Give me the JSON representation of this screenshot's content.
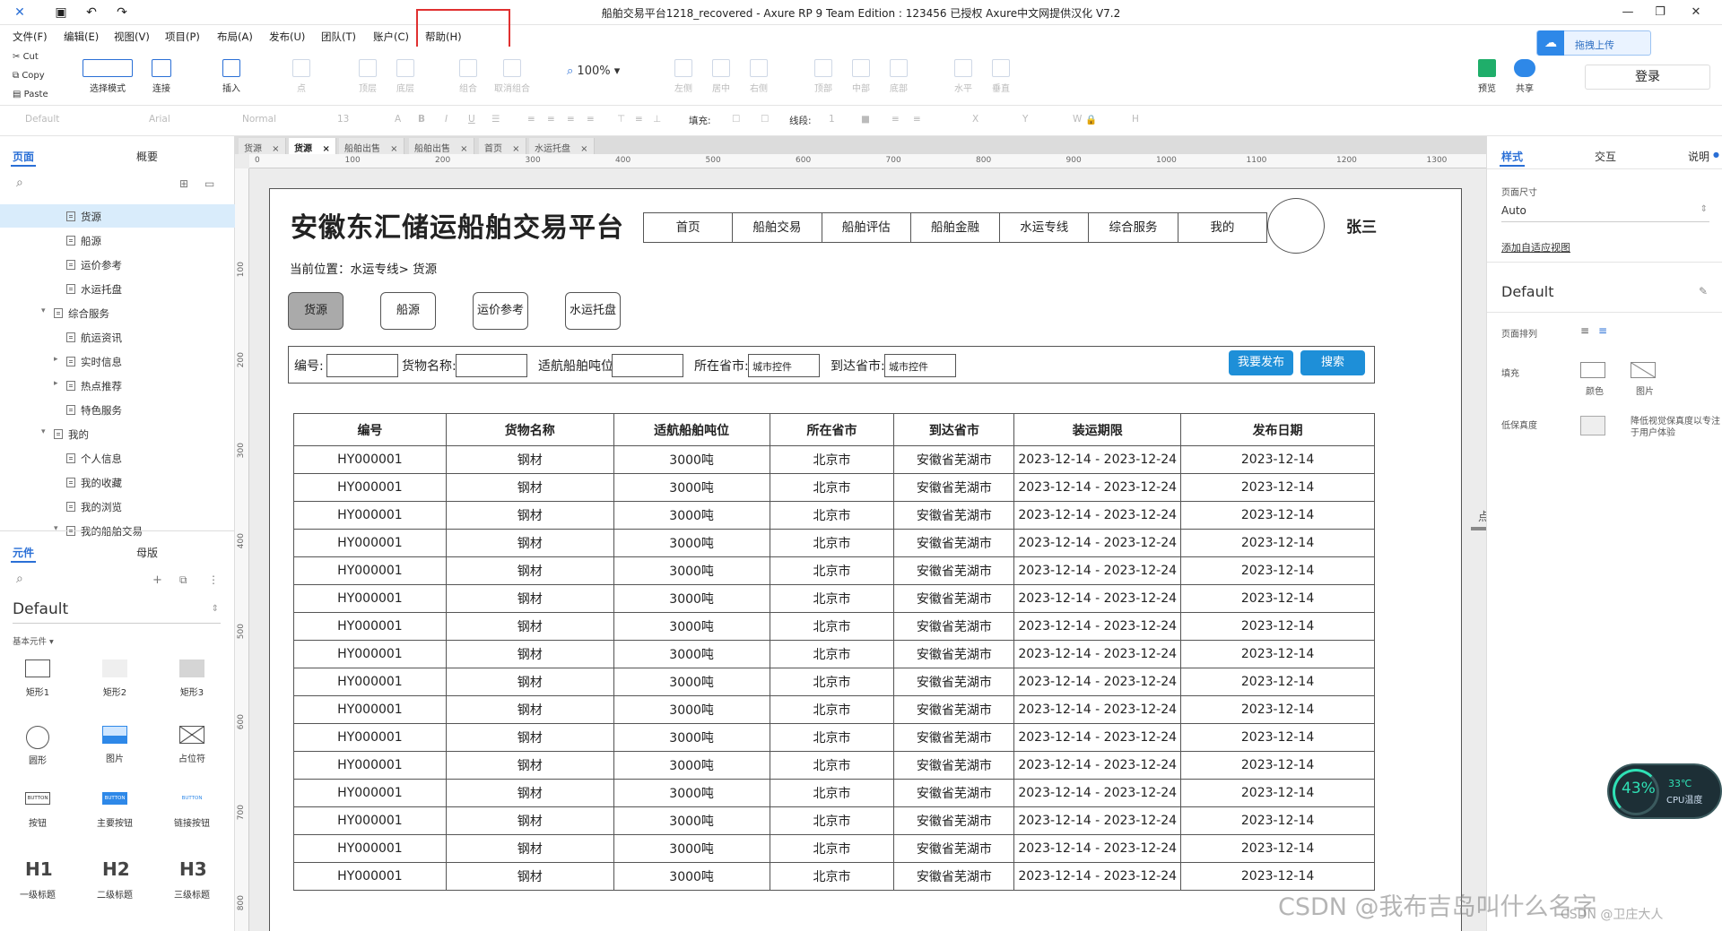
{
  "window": {
    "title": "船舶交易平台1218_recovered - Axure RP 9 Team Edition : 123456 已授权      Axure中文网提供汉化 V7.2"
  },
  "menu": [
    "文件(F)",
    "编辑(E)",
    "视图(V)",
    "项目(P)",
    "布局(A)",
    "发布(U)",
    "团队(T)",
    "账户(C)",
    "帮助(H)"
  ],
  "clipboard": {
    "cut": "Cut",
    "copy": "Copy",
    "paste": "Paste"
  },
  "toolbar": {
    "select_mode": "选择模式",
    "connect": "连接",
    "insert": "插入",
    "point": "点",
    "top_layer": "顶层",
    "bottom_layer": "底层",
    "group": "组合",
    "ungroup": "取消组合",
    "zoom": "100%",
    "align_left": "左侧",
    "align_center": "居中",
    "align_right": "右侧",
    "align_top": "顶部",
    "align_middle": "中部",
    "align_bottom": "底部",
    "dist_h": "水平",
    "dist_v": "垂直",
    "preview": "预览",
    "share": "共享",
    "upload": "拖拽上传",
    "login": "登录"
  },
  "format": {
    "style": "Default",
    "font": "Arial",
    "weight": "Normal",
    "size": "13",
    "fill": "填充:",
    "line": "线段:",
    "line_width": "1",
    "x": "X",
    "y": "Y",
    "w": "W",
    "h": "H"
  },
  "left_panel": {
    "tabs": [
      "页面",
      "概要"
    ],
    "pages": [
      {
        "label": "货源",
        "indent": 1,
        "selected": true
      },
      {
        "label": "船源",
        "indent": 1
      },
      {
        "label": "运价参考",
        "indent": 1
      },
      {
        "label": "水运托盘",
        "indent": 1
      },
      {
        "label": "综合服务",
        "indent": 0,
        "arrow": "▾"
      },
      {
        "label": "航运资讯",
        "indent": 1
      },
      {
        "label": "实时信息",
        "indent": 1,
        "arrow": "▸"
      },
      {
        "label": "热点推荐",
        "indent": 1,
        "arrow": "▸"
      },
      {
        "label": "特色服务",
        "indent": 1
      },
      {
        "label": "我的",
        "indent": 0,
        "arrow": "▾"
      },
      {
        "label": "个人信息",
        "indent": 1
      },
      {
        "label": "我的收藏",
        "indent": 1
      },
      {
        "label": "我的浏览",
        "indent": 1
      },
      {
        "label": "我的船舶交易",
        "indent": 1,
        "arrow": "▾"
      }
    ],
    "widget_tabs": [
      "元件",
      "母版"
    ],
    "library": "Default",
    "library_section": "基本元件 ▾",
    "widgets": [
      {
        "label": "矩形1",
        "icon": "rect-icon"
      },
      {
        "label": "矩形2",
        "icon": "rect-gray-icon"
      },
      {
        "label": "矩形3",
        "icon": "rect-dark-icon"
      },
      {
        "label": "圆形",
        "icon": "circle-icon"
      },
      {
        "label": "图片",
        "icon": "image-icon"
      },
      {
        "label": "占位符",
        "icon": "placeholder-icon"
      },
      {
        "label": "按钮",
        "icon": "button-icon",
        "text": "BUTTON"
      },
      {
        "label": "主要按钮",
        "icon": "primary-button-icon",
        "text": "BUTTON"
      },
      {
        "label": "链接按钮",
        "icon": "link-button-icon",
        "text": "BUTTON"
      },
      {
        "label": "一级标题",
        "icon": "h1-icon",
        "text": "H1"
      },
      {
        "label": "二级标题",
        "icon": "h2-icon",
        "text": "H2"
      },
      {
        "label": "三级标题",
        "icon": "h3-icon",
        "text": "H3"
      }
    ]
  },
  "doc_tabs": [
    {
      "label": "货源",
      "active": false
    },
    {
      "label": "货源",
      "active": true
    },
    {
      "label": "船舶出售",
      "active": false
    },
    {
      "label": "船舶出售",
      "active": false
    },
    {
      "label": "首页",
      "active": false
    },
    {
      "label": "水运托盘",
      "active": false
    }
  ],
  "ruler": {
    "h": [
      "0",
      "100",
      "200",
      "300",
      "400",
      "500",
      "600",
      "700",
      "800",
      "900",
      "1000",
      "1100",
      "1200",
      "1300"
    ],
    "v": [
      "100",
      "200",
      "300",
      "400",
      "500",
      "600",
      "700",
      "800"
    ]
  },
  "design": {
    "site_title": "安徽东汇储运船舶交易平台",
    "nav": [
      "首页",
      "船舶交易",
      "船舶评估",
      "船舶金融",
      "水运专线",
      "综合服务",
      "我的"
    ],
    "username": "张三",
    "breadcrumb": "当前位置：水运专线> 货源",
    "categories": [
      {
        "label": "货源",
        "active": true
      },
      {
        "label": "船源",
        "active": false
      },
      {
        "label": "运价参考",
        "active": false
      },
      {
        "label": "水运托盘",
        "active": false
      }
    ],
    "filter": {
      "number_label": "编号:",
      "cargo_label": "货物名称:",
      "tonnage_label": "适航船舶吨位:",
      "from_label": "所在省市:",
      "from_value": "城市控件",
      "to_label": "到达省市:",
      "to_value": "城市控件",
      "publish_btn": "我要发布",
      "search_btn": "搜索"
    },
    "table": {
      "headers": [
        "编号",
        "货物名称",
        "适航船舶吨位",
        "所在省市",
        "到达省市",
        "装运期限",
        "发布日期"
      ],
      "rows": [
        [
          "HY000001",
          "钢材",
          "3000吨",
          "北京市",
          "安徽省芜湖市",
          "2023-12-14 - 2023-12-24",
          "2023-12-14"
        ],
        [
          "HY000001",
          "钢材",
          "3000吨",
          "北京市",
          "安徽省芜湖市",
          "2023-12-14 - 2023-12-24",
          "2023-12-14"
        ],
        [
          "HY000001",
          "钢材",
          "3000吨",
          "北京市",
          "安徽省芜湖市",
          "2023-12-14 - 2023-12-24",
          "2023-12-14"
        ],
        [
          "HY000001",
          "钢材",
          "3000吨",
          "北京市",
          "安徽省芜湖市",
          "2023-12-14 - 2023-12-24",
          "2023-12-14"
        ],
        [
          "HY000001",
          "钢材",
          "3000吨",
          "北京市",
          "安徽省芜湖市",
          "2023-12-14 - 2023-12-24",
          "2023-12-14"
        ],
        [
          "HY000001",
          "钢材",
          "3000吨",
          "北京市",
          "安徽省芜湖市",
          "2023-12-14 - 2023-12-24",
          "2023-12-14"
        ],
        [
          "HY000001",
          "钢材",
          "3000吨",
          "北京市",
          "安徽省芜湖市",
          "2023-12-14 - 2023-12-24",
          "2023-12-14"
        ],
        [
          "HY000001",
          "钢材",
          "3000吨",
          "北京市",
          "安徽省芜湖市",
          "2023-12-14 - 2023-12-24",
          "2023-12-14"
        ],
        [
          "HY000001",
          "钢材",
          "3000吨",
          "北京市",
          "安徽省芜湖市",
          "2023-12-14 - 2023-12-24",
          "2023-12-14"
        ],
        [
          "HY000001",
          "钢材",
          "3000吨",
          "北京市",
          "安徽省芜湖市",
          "2023-12-14 - 2023-12-24",
          "2023-12-14"
        ],
        [
          "HY000001",
          "钢材",
          "3000吨",
          "北京市",
          "安徽省芜湖市",
          "2023-12-14 - 2023-12-24",
          "2023-12-14"
        ],
        [
          "HY000001",
          "钢材",
          "3000吨",
          "北京市",
          "安徽省芜湖市",
          "2023-12-14 - 2023-12-24",
          "2023-12-14"
        ],
        [
          "HY000001",
          "钢材",
          "3000吨",
          "北京市",
          "安徽省芜湖市",
          "2023-12-14 - 2023-12-24",
          "2023-12-14"
        ],
        [
          "HY000001",
          "钢材",
          "3000吨",
          "北京市",
          "安徽省芜湖市",
          "2023-12-14 - 2023-12-24",
          "2023-12-14"
        ],
        [
          "HY000001",
          "钢材",
          "3000吨",
          "北京市",
          "安徽省芜湖市",
          "2023-12-14 - 2023-12-24",
          "2023-12-14"
        ],
        [
          "HY000001",
          "钢材",
          "3000吨",
          "北京市",
          "安徽省芜湖市",
          "2023-12-14 - 2023-12-24",
          "2023-12-14"
        ]
      ]
    }
  },
  "right_panel": {
    "tabs": [
      "样式",
      "交互",
      "说明"
    ],
    "page_size_label": "页面尺寸",
    "page_size_value": "Auto",
    "adaptive_link": "添加自适应视图",
    "style_name": "Default",
    "page_align_label": "页面排列",
    "fill_label": "填充",
    "fill_color": "颜色",
    "fill_image": "图片",
    "low_fidelity_label": "低保真度",
    "low_fidelity_desc": "降低视觉保真度以专注于用户体验"
  },
  "cpu": {
    "percent": "43%",
    "temp": "33℃",
    "caption": "CPU温度"
  },
  "watermark": "CSDN @我布吉岛叫什么名字",
  "watermark2": "CSDN @卫庄大人"
}
